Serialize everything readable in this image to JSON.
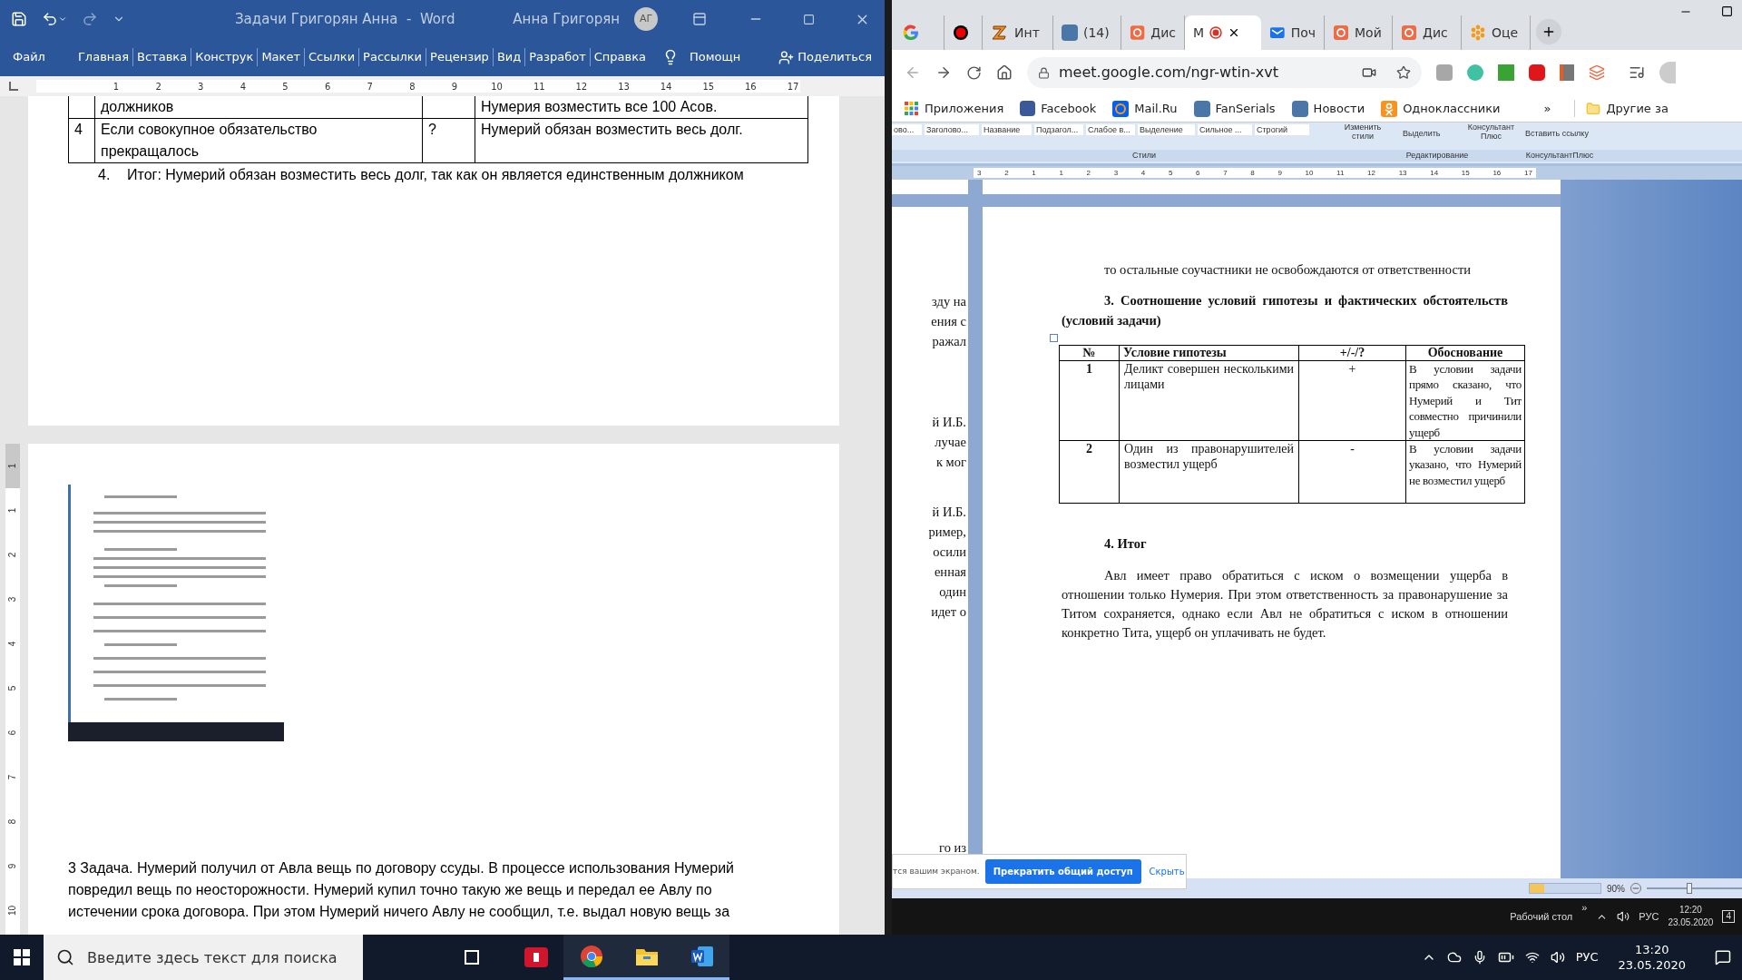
{
  "word": {
    "title": "Задачи Григорян Анна  -  Word",
    "user": "Анна Григорян",
    "avatar": "АГ",
    "ribbon_tabs": [
      "Файл",
      "Главная",
      "Вставка",
      "Конструк",
      "Макет",
      "Ссылки",
      "Рассылки",
      "Рецензир",
      "Вид",
      "Разработ",
      "Справка"
    ],
    "tell_me": "Помощн",
    "share": "Поделиться",
    "ruler": [
      "1",
      "2",
      "3",
      "4",
      "5",
      "6",
      "7",
      "8",
      "9",
      "10",
      "11",
      "12",
      "13",
      "14",
      "15",
      "16",
      "17"
    ],
    "vertical_ruler": [
      "1",
      "1",
      "2",
      "3",
      "4",
      "5",
      "6",
      "7",
      "8",
      "9",
      "10"
    ],
    "table_rows": [
      {
        "condition": "должников",
        "result": "Нумерия возместить все 100 Асов."
      },
      {
        "number": "4",
        "condition": "Если совокупное обязательство прекращалось",
        "mark": "?",
        "result": "Нумерий обязан возместить весь долг."
      }
    ],
    "conclusion": {
      "number": "4.",
      "text": "Итог: Нумерий обязан возместить весь долг, так как он является единственным должником"
    },
    "page2": {
      "image": {
        "kind": "picture"
      },
      "lines": [
        "3 Задача. Нумерий получил от Авла вещь по договору ссуды. В процессе использования Нумерий",
        "повредил вещь по неосторожности. Нумерий купил точно такую же вещь и передал ее Авлу по",
        "истечении срока договора. При этом Нумерий ничего Авлу не сообщил, т.е. выдал новую вещь за"
      ]
    }
  },
  "browser": {
    "tabs": [
      {
        "kind": "google",
        "selected": false
      },
      {
        "kind": "record",
        "selected": false
      },
      {
        "kind": "z",
        "label": "Инт",
        "selected": false
      },
      {
        "kind": "vk",
        "label": "(14)",
        "selected": false
      },
      {
        "kind": "flower",
        "label": "Дис",
        "selected": false
      },
      {
        "label": "М",
        "recording": true,
        "selected": true
      },
      {
        "kind": "mail",
        "label": "Поч",
        "selected": false
      },
      {
        "kind": "flower",
        "label": "Мой",
        "selected": false
      },
      {
        "kind": "flower",
        "label": "Дис",
        "selected": false
      },
      {
        "kind": "dots",
        "label": "Оце",
        "selected": false
      }
    ],
    "address": "meet.google.com/ngr-wtin-xvt",
    "bookmarks": [
      {
        "kind": "apps",
        "label": "Приложения"
      },
      {
        "kind": "facebook",
        "label": "Facebook"
      },
      {
        "kind": "mailru",
        "label": "Mail.Ru"
      },
      {
        "kind": "vk",
        "label": "FanSerials"
      },
      {
        "kind": "vk",
        "label": "Новости"
      },
      {
        "kind": "ok",
        "label": "Одноклассники"
      }
    ],
    "bookmarks_more": "»",
    "other_bookmarks": "Другие за",
    "shared_screen": {
      "ribbon": {
        "gallery": [
          "ово...",
          "Заголово...",
          "Название",
          "Подзагол...",
          "Слабое в...",
          "Выделение",
          "Сильное ...",
          "Строгий"
        ],
        "change_styles": "Изменить стили",
        "select": "Выделить",
        "consultant": "Консультант Плюс",
        "insert_link": "Вставить ссылку",
        "groups": [
          "Стили",
          "Редактирование",
          "КонсультантПлюс"
        ]
      },
      "ruler": [
        "3",
        "2",
        "1",
        "1",
        "2",
        "3",
        "4",
        "5",
        "6",
        "7",
        "8",
        "9",
        "10",
        "11",
        "12",
        "13",
        "14",
        "15",
        "16",
        "17"
      ],
      "left_fragments": [
        [
          "зду на",
          "ения с",
          "ражал"
        ],
        [
          "й И.Б.",
          "лучае",
          "к мог"
        ],
        [
          "й И.Б.",
          "ример,",
          "осили",
          "енная",
          "один",
          "идет о"
        ],
        [
          "го из"
        ]
      ],
      "page": {
        "intro": "то остальные соучастники не освобождаются от ответственности",
        "heading": "3. Соотношение условий гипотезы и фактических обстоятельств (условий задачи)",
        "columns": [
          "№",
          "Условие гипотезы",
          "+/-/?",
          "Обоснование"
        ],
        "rows": [
          {
            "number": "1",
            "condition": "Деликт совершен несколькими лицами",
            "mark": "+",
            "reason": "В условии задачи прямо сказано, что Нумерий и Тит совместно причинили ущерб"
          },
          {
            "number": "2",
            "condition": "Один из правонарушителей возместил ущерб",
            "mark": "-",
            "reason": "В условии задачи указано, что Нумерий не возместил ущерб"
          }
        ],
        "result_heading": "4. Итог",
        "result": "Авл имеет право обратиться с иском о возмещении ущерба в отношении только Нумерия. При этом ответственность за правонарушение за Титом сохраняется, однако если Авл не обратиться с иском в отношении конкретно Тита, ущерб он уплачивать не будет."
      },
      "status_zoom": "90%",
      "zoom_slider": {
        "level": 0.45
      },
      "taskbar": {
        "desktop": "Рабочий стол",
        "chevron": "»",
        "lang": "РУС",
        "time": "12:20",
        "date": "23.05.2020",
        "notifications": "4"
      },
      "share_bar": {
        "message": "тся вашим экраном.",
        "stop": "Прекратить общий доступ",
        "hide": "Скрыть"
      }
    }
  },
  "taskbar": {
    "search_placeholder": "Введите здесь текст для поиска",
    "apps": [
      {
        "kind": "download",
        "open": false
      },
      {
        "kind": "chrome",
        "open": true
      },
      {
        "kind": "explorer",
        "open": true
      },
      {
        "kind": "word",
        "open": true
      }
    ],
    "lang": "РУС",
    "time": "13:20",
    "date": "23.05.2020"
  }
}
